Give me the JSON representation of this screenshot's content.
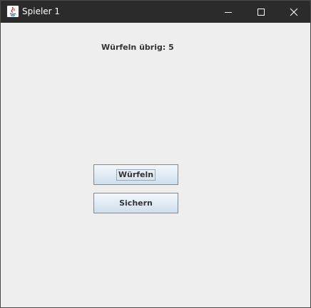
{
  "window": {
    "title": "Spieler 1",
    "app_icon": "java-icon",
    "controls": [
      "minimize-icon",
      "maximize-icon",
      "close-icon"
    ]
  },
  "main": {
    "status_text": "Würfeln übrig: 5",
    "buttons": {
      "roll_label": "Würfeln",
      "save_label": "Sichern",
      "focused": "roll"
    }
  },
  "colors": {
    "titlebar": "#2b2b2b",
    "background": "#eeeeee",
    "button_border": "#7a8a99"
  }
}
